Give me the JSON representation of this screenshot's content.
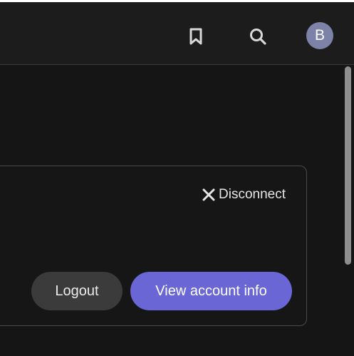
{
  "header": {
    "bookmark_icon": "bookmark-icon",
    "search_icon": "search-icon",
    "avatar_initial": "B",
    "avatar_color": "#7d83a8"
  },
  "card": {
    "disconnect_label": "Disconnect",
    "disconnect_icon": "close-icon",
    "logout_label": "Logout",
    "view_account_label": "View account info"
  },
  "colors": {
    "background": "#151515",
    "accent": "#6b66d6",
    "secondary_button": "#3b3b3b"
  }
}
